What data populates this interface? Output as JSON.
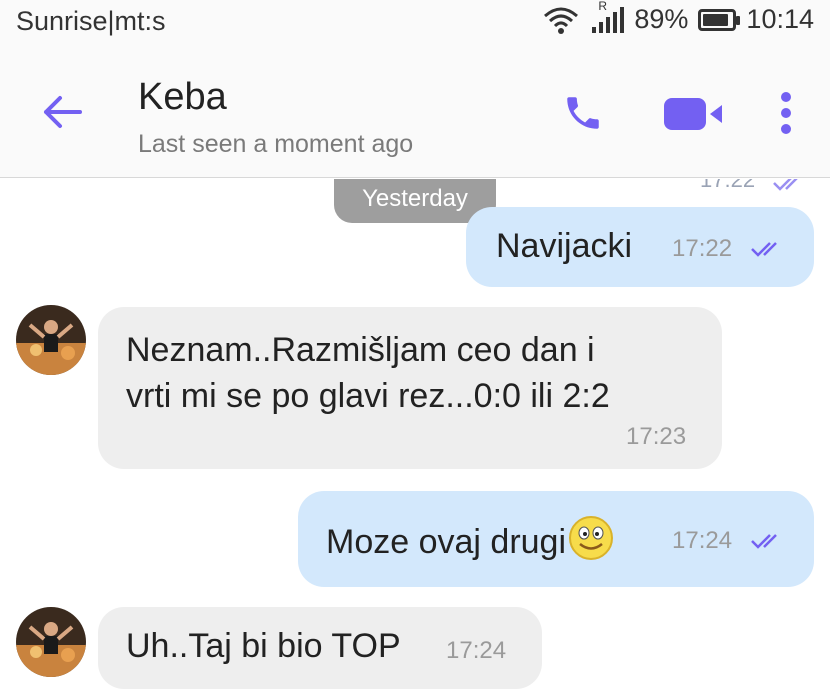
{
  "status_bar": {
    "carrier": "Sunrise|mt:s",
    "battery": "89%",
    "battery_level": 0.89,
    "time": "10:14",
    "signal_badge": "R"
  },
  "header": {
    "name": "Keba",
    "last_seen": "Last seen a moment ago"
  },
  "chat": {
    "previous_timestamp": "17:22",
    "date_divider": "Yesterday",
    "messages": [
      {
        "direction": "out",
        "text": "Navijacki",
        "time": "17:22"
      },
      {
        "direction": "in",
        "text": "Neznam..Razmišljam ceo dan i\nvrti mi se po glavi rez...0:0 ili 2:2",
        "time": "17:23"
      },
      {
        "direction": "out",
        "text": "Moze ovaj drugi",
        "emoji": "smiley-emoji",
        "time": "17:24"
      },
      {
        "direction": "in",
        "text": "Uh..Taj bi bio TOP",
        "time": "17:24"
      }
    ]
  },
  "colors": {
    "accent": "#7360f2",
    "outgoing_bubble": "#d3e8fc",
    "incoming_bubble": "#eeeeee",
    "date_pill": "#9e9e9e"
  }
}
